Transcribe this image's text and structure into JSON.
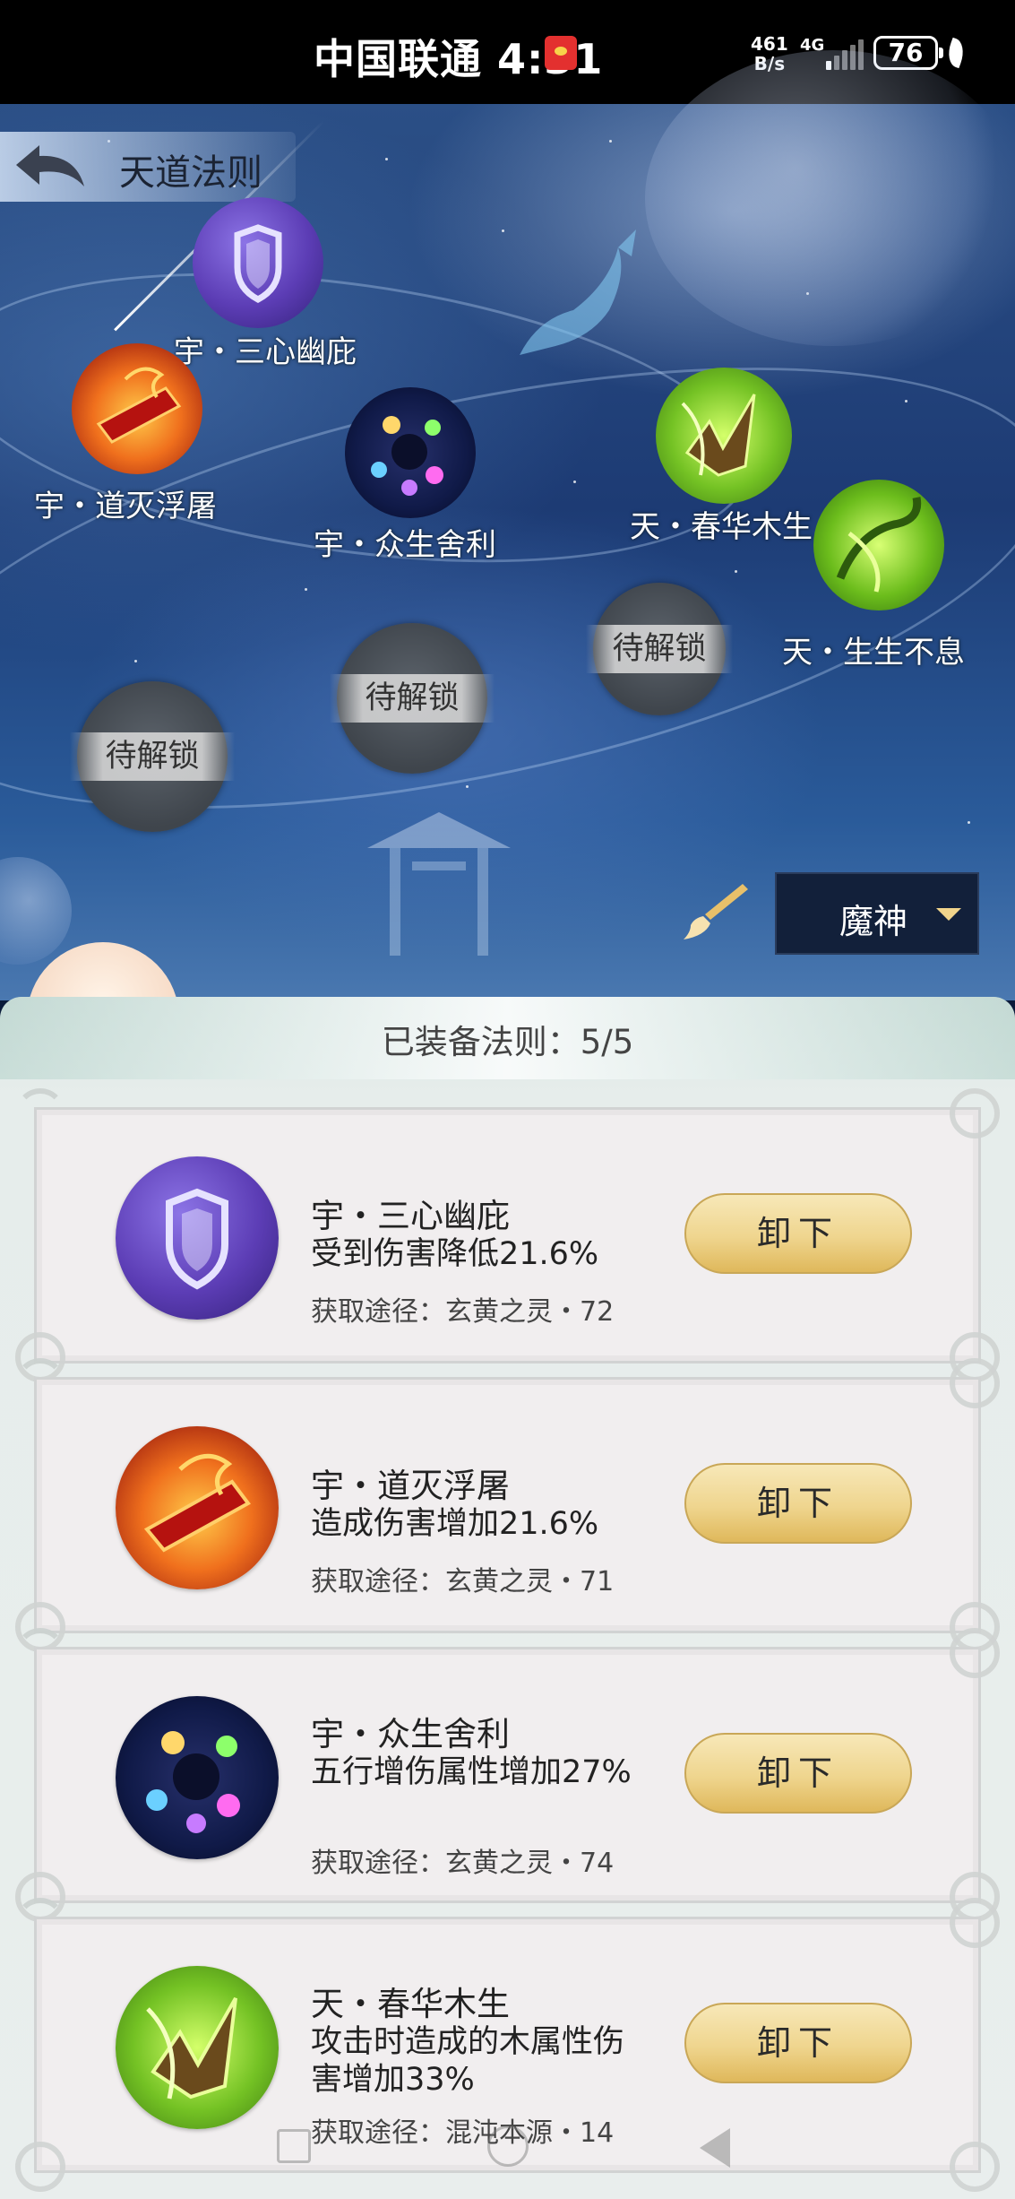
{
  "status_bar": {
    "carrier_time": "中国联通 4:31",
    "net_speed_value": "461",
    "net_speed_unit": "B/s",
    "network": "4G",
    "battery": "76"
  },
  "header": {
    "title": "天道法则"
  },
  "starmap": {
    "nodes": [
      {
        "label": "宇・三心幽庇",
        "icon": "shield-icon"
      },
      {
        "label": "宇・道灭浮屠",
        "icon": "fire-blade-icon"
      },
      {
        "label": "宇・众生舍利",
        "icon": "cosmic-orbs-icon"
      },
      {
        "label": "天・春华木生",
        "icon": "leaf-spear-icon"
      },
      {
        "label": "天・生生不息",
        "icon": "vine-icon"
      }
    ],
    "locked_label": "待解锁"
  },
  "mode_select": {
    "value": "魔神"
  },
  "equipped": {
    "title": "已装备法则：5/5",
    "unequip_label": "卸下",
    "items": [
      {
        "name": "宇・三心幽庇",
        "effect": "受到伤害降低21.6%",
        "source": "获取途径：玄黄之灵・72",
        "icon": "shield-icon"
      },
      {
        "name": "宇・道灭浮屠",
        "effect": "造成伤害增加21.6%",
        "source": "获取途径：玄黄之灵・71",
        "icon": "fire-blade-icon"
      },
      {
        "name": "宇・众生舍利",
        "effect": "五行增伤属性增加27%",
        "source": "获取途径：玄黄之灵・74",
        "icon": "cosmic-orbs-icon"
      },
      {
        "name": "天・春华木生",
        "effect": "攻击时造成的木属性伤害增加33%",
        "source": "获取途径：混沌本源・14",
        "icon": "leaf-spear-icon"
      }
    ]
  }
}
